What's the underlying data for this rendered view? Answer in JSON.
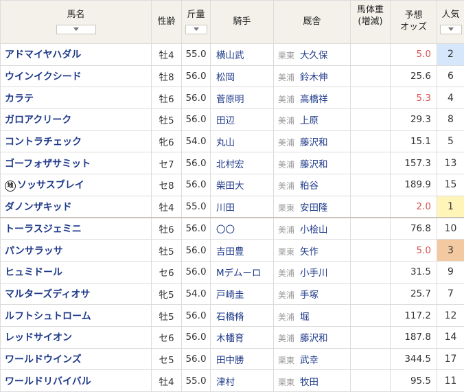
{
  "headers": {
    "name": "馬名",
    "sex_age": "性齢",
    "weight_carried": "斤量",
    "jockey": "騎手",
    "stable": "厩舎",
    "body_weight": "馬体重",
    "body_weight_sub": "(増減)",
    "odds": "予想",
    "odds_sub": "オッズ",
    "popularity": "人気"
  },
  "rows": [
    {
      "name": "アドマイヤハダル",
      "sex_age": "牡4",
      "kg": "55.0",
      "jockey": "横山武",
      "area": "栗東",
      "trainer": "大久保",
      "odds": "5.0",
      "hot": true,
      "pop": "2",
      "pop_rank": 2
    },
    {
      "name": "ウインイクシード",
      "sex_age": "牡8",
      "kg": "56.0",
      "jockey": "松岡",
      "area": "美浦",
      "trainer": "鈴木伸",
      "odds": "25.6",
      "hot": false,
      "pop": "6",
      "pop_rank": 0
    },
    {
      "name": "カラテ",
      "sex_age": "牡6",
      "kg": "56.0",
      "jockey": "菅原明",
      "area": "美浦",
      "trainer": "高橋祥",
      "odds": "5.3",
      "hot": true,
      "pop": "4",
      "pop_rank": 0
    },
    {
      "name": "ガロアクリーク",
      "sex_age": "牡5",
      "kg": "56.0",
      "jockey": "田辺",
      "area": "美浦",
      "trainer": "上原",
      "odds": "29.3",
      "hot": false,
      "pop": "8",
      "pop_rank": 0
    },
    {
      "name": "コントラチェック",
      "sex_age": "牝6",
      "kg": "54.0",
      "jockey": "丸山",
      "area": "美浦",
      "trainer": "藤沢和",
      "odds": "15.1",
      "hot": false,
      "pop": "5",
      "pop_rank": 0
    },
    {
      "name": "ゴーフォザサミット",
      "sex_age": "セ7",
      "kg": "56.0",
      "jockey": "北村宏",
      "area": "美浦",
      "trainer": "藤沢和",
      "odds": "157.3",
      "hot": false,
      "pop": "13",
      "pop_rank": 0
    },
    {
      "name": "ソッサスブレイ",
      "badge": "地",
      "sex_age": "セ8",
      "kg": "56.0",
      "jockey": "柴田大",
      "area": "美浦",
      "trainer": "粕谷",
      "odds": "189.9",
      "hot": false,
      "pop": "15",
      "pop_rank": 0
    },
    {
      "name": "ダノンザキッド",
      "sex_age": "牡4",
      "kg": "55.0",
      "jockey": "川田",
      "area": "栗東",
      "trainer": "安田隆",
      "odds": "2.0",
      "hot": true,
      "pop": "1",
      "pop_rank": 1
    },
    {
      "name": "トーラスジェミニ",
      "sex_age": "牡6",
      "kg": "56.0",
      "jockey": "〇〇",
      "area": "美浦",
      "trainer": "小桧山",
      "odds": "76.8",
      "hot": false,
      "pop": "10",
      "pop_rank": 0,
      "divider": true
    },
    {
      "name": "パンサラッサ",
      "sex_age": "牡5",
      "kg": "56.0",
      "jockey": "吉田豊",
      "area": "栗東",
      "trainer": "矢作",
      "odds": "5.0",
      "hot": true,
      "pop": "3",
      "pop_rank": 3
    },
    {
      "name": "ヒュミドール",
      "sex_age": "セ6",
      "kg": "56.0",
      "jockey": "Mデムーロ",
      "area": "美浦",
      "trainer": "小手川",
      "odds": "31.5",
      "hot": false,
      "pop": "9",
      "pop_rank": 0
    },
    {
      "name": "マルターズディオサ",
      "sex_age": "牝5",
      "kg": "54.0",
      "jockey": "戸崎圭",
      "area": "美浦",
      "trainer": "手塚",
      "odds": "25.7",
      "hot": false,
      "pop": "7",
      "pop_rank": 0
    },
    {
      "name": "ルフトシュトローム",
      "sex_age": "牡5",
      "kg": "56.0",
      "jockey": "石橋脩",
      "area": "美浦",
      "trainer": "堀",
      "odds": "117.2",
      "hot": false,
      "pop": "12",
      "pop_rank": 0
    },
    {
      "name": "レッドサイオン",
      "sex_age": "セ6",
      "kg": "56.0",
      "jockey": "木幡育",
      "area": "美浦",
      "trainer": "藤沢和",
      "odds": "187.8",
      "hot": false,
      "pop": "14",
      "pop_rank": 0
    },
    {
      "name": "ワールドウインズ",
      "sex_age": "セ5",
      "kg": "56.0",
      "jockey": "田中勝",
      "area": "栗東",
      "trainer": "武幸",
      "odds": "344.5",
      "hot": false,
      "pop": "17",
      "pop_rank": 0
    },
    {
      "name": "ワールドリバイバル",
      "sex_age": "牡4",
      "kg": "55.0",
      "jockey": "津村",
      "area": "栗東",
      "trainer": "牧田",
      "odds": "95.5",
      "hot": false,
      "pop": "11",
      "pop_rank": 0
    }
  ],
  "colors": {
    "header_bg": "#f3f1ea",
    "link": "#1f3a8a",
    "hot_odds": "#d9534f",
    "pop1_bg": "#fff5b8",
    "pop2_bg": "#d6e6fb",
    "pop3_bg": "#f3c9a2"
  }
}
